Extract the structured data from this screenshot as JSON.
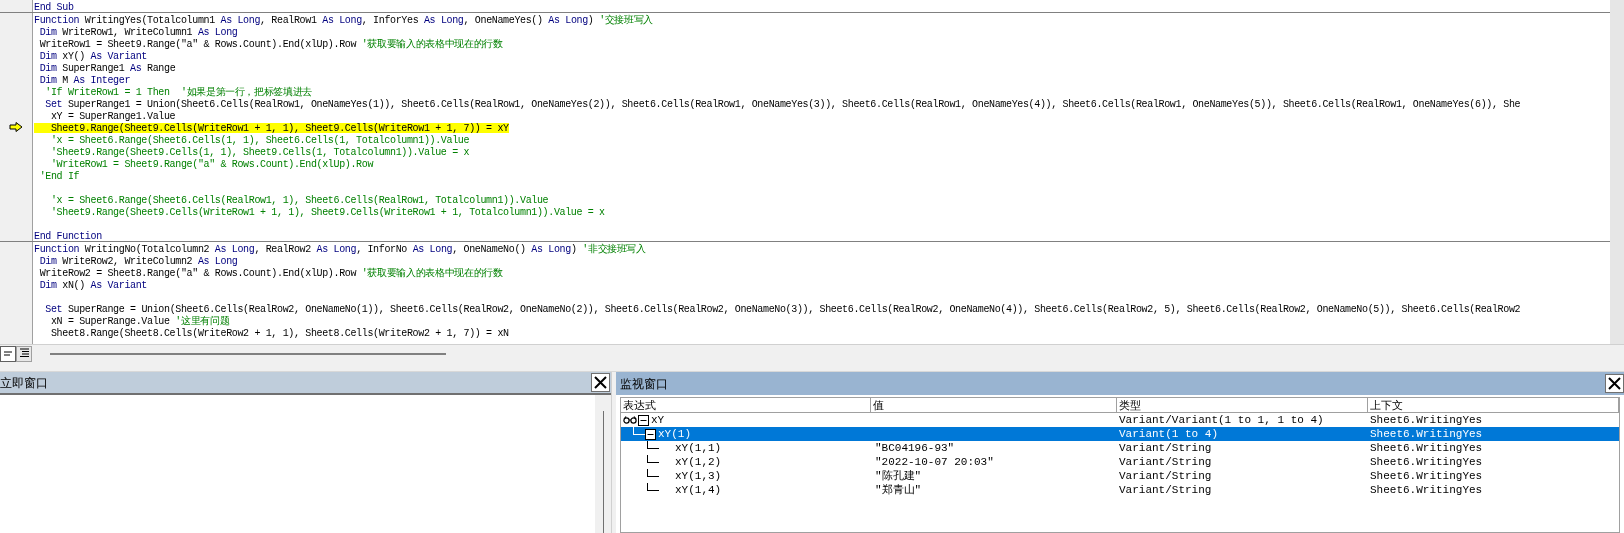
{
  "code_editor": {
    "procedures": [
      {
        "lines": [
          {
            "current": false,
            "segments": [
              {
                "kind": "keyword",
                "text": "End Sub"
              }
            ]
          }
        ]
      },
      {
        "lines": [
          {
            "current": false,
            "segments": [
              {
                "kind": "keyword",
                "text": "Function"
              },
              {
                "kind": "plain",
                "text": " WritingYes(Totalcolumn1 "
              },
              {
                "kind": "keyword",
                "text": "As Long"
              },
              {
                "kind": "plain",
                "text": ", RealRow1 "
              },
              {
                "kind": "keyword",
                "text": "As Long"
              },
              {
                "kind": "plain",
                "text": ", InforYes "
              },
              {
                "kind": "keyword",
                "text": "As Long"
              },
              {
                "kind": "plain",
                "text": ", OneNameYes() "
              },
              {
                "kind": "keyword",
                "text": "As Long"
              },
              {
                "kind": "plain",
                "text": ") "
              },
              {
                "kind": "comment",
                "text": "'交接班写入"
              }
            ]
          },
          {
            "current": false,
            "segments": [
              {
                "kind": "keyword",
                "text": " Dim"
              },
              {
                "kind": "plain",
                "text": " WriteRow1, WriteColumn1 "
              },
              {
                "kind": "keyword",
                "text": "As Long"
              }
            ]
          },
          {
            "current": false,
            "segments": [
              {
                "kind": "plain",
                "text": " WriteRow1 = Sheet9.Range(\"a\" & Rows.Count).End(xlUp).Row "
              },
              {
                "kind": "comment",
                "text": "'获取要输入的表格中现在的行数"
              }
            ]
          },
          {
            "current": false,
            "segments": [
              {
                "kind": "keyword",
                "text": " Dim"
              },
              {
                "kind": "plain",
                "text": " xY() "
              },
              {
                "kind": "keyword",
                "text": "As Variant"
              }
            ]
          },
          {
            "current": false,
            "segments": [
              {
                "kind": "keyword",
                "text": " Dim"
              },
              {
                "kind": "plain",
                "text": " SuperRange1 "
              },
              {
                "kind": "keyword",
                "text": "As"
              },
              {
                "kind": "plain",
                "text": " Range"
              }
            ]
          },
          {
            "current": false,
            "segments": [
              {
                "kind": "keyword",
                "text": " Dim"
              },
              {
                "kind": "plain",
                "text": " M "
              },
              {
                "kind": "keyword",
                "text": "As Integer"
              }
            ]
          },
          {
            "current": false,
            "segments": [
              {
                "kind": "comment",
                "text": "  'If WriteRow1 = 1 Then  '如果是第一行，把标签填进去"
              }
            ]
          },
          {
            "current": false,
            "segments": [
              {
                "kind": "keyword",
                "text": "  Set"
              },
              {
                "kind": "plain",
                "text": " SuperRange1 = Union(Sheet6.Cells(RealRow1, OneNameYes(1)), Sheet6.Cells(RealRow1, OneNameYes(2)), Sheet6.Cells(RealRow1, OneNameYes(3)), Sheet6.Cells(RealRow1, OneNameYes(4)), Sheet6.Cells(RealRow1, OneNameYes(5)), Sheet6.Cells(RealRow1, OneNameYes(6)), She"
              }
            ]
          },
          {
            "current": false,
            "segments": [
              {
                "kind": "plain",
                "text": "   xY = SuperRange1.Value"
              }
            ]
          },
          {
            "current": true,
            "segments": [
              {
                "kind": "plain",
                "text": "   Sheet9.Range(Sheet9.Cells(WriteRow1 + 1, 1), Sheet9.Cells(WriteRow1 + 1, 7)) = xY"
              }
            ]
          },
          {
            "current": false,
            "segments": [
              {
                "kind": "comment",
                "text": "   'x = Sheet6.Range(Sheet6.Cells(1, 1), Sheet6.Cells(1, Totalcolumn1)).Value"
              }
            ]
          },
          {
            "current": false,
            "segments": [
              {
                "kind": "comment",
                "text": "   'Sheet9.Range(Sheet9.Cells(1, 1), Sheet9.Cells(1, Totalcolumn1)).Value = x"
              }
            ]
          },
          {
            "current": false,
            "segments": [
              {
                "kind": "comment",
                "text": "   'WriteRow1 = Sheet9.Range(\"a\" & Rows.Count).End(xlUp).Row"
              }
            ]
          },
          {
            "current": false,
            "segments": [
              {
                "kind": "comment",
                "text": " 'End If"
              }
            ]
          },
          {
            "current": false
          },
          {
            "current": false,
            "segments": [
              {
                "kind": "comment",
                "text": "   'x = Sheet6.Range(Sheet6.Cells(RealRow1, 1), Sheet6.Cells(RealRow1, Totalcolumn1)).Value"
              }
            ]
          },
          {
            "current": false,
            "segments": [
              {
                "kind": "comment",
                "text": "   'Sheet9.Range(Sheet9.Cells(WriteRow1 + 1, 1), Sheet9.Cells(WriteRow1 + 1, Totalcolumn1)).Value = x"
              }
            ]
          },
          {
            "current": false
          },
          {
            "current": false,
            "segments": [
              {
                "kind": "keyword",
                "text": "End Function"
              }
            ]
          }
        ]
      },
      {
        "lines": [
          {
            "current": false,
            "segments": [
              {
                "kind": "keyword",
                "text": "Function"
              },
              {
                "kind": "plain",
                "text": " WritingNo(Totalcolumn2 "
              },
              {
                "kind": "keyword",
                "text": "As Long"
              },
              {
                "kind": "plain",
                "text": ", RealRow2 "
              },
              {
                "kind": "keyword",
                "text": "As Long"
              },
              {
                "kind": "plain",
                "text": ", InforNo "
              },
              {
                "kind": "keyword",
                "text": "As Long"
              },
              {
                "kind": "plain",
                "text": ", OneNameNo() "
              },
              {
                "kind": "keyword",
                "text": "As Long"
              },
              {
                "kind": "plain",
                "text": ") "
              },
              {
                "kind": "comment",
                "text": "'非交接班写入"
              }
            ]
          },
          {
            "current": false,
            "segments": [
              {
                "kind": "keyword",
                "text": " Dim"
              },
              {
                "kind": "plain",
                "text": " WriteRow2, WriteColumn2 "
              },
              {
                "kind": "keyword",
                "text": "As Long"
              }
            ]
          },
          {
            "current": false,
            "segments": [
              {
                "kind": "plain",
                "text": " WriteRow2 = Sheet8.Range(\"a\" & Rows.Count).End(xlUp).Row "
              },
              {
                "kind": "comment",
                "text": "'获取要输入的表格中现在的行数"
              }
            ]
          },
          {
            "current": false,
            "segments": [
              {
                "kind": "keyword",
                "text": " Dim"
              },
              {
                "kind": "plain",
                "text": " xN() "
              },
              {
                "kind": "keyword",
                "text": "As Variant"
              }
            ]
          },
          {
            "current": false
          },
          {
            "current": false,
            "segments": [
              {
                "kind": "keyword",
                "text": "  Set"
              },
              {
                "kind": "plain",
                "text": " SuperRange = Union(Sheet6.Cells(RealRow2, OneNameNo(1)), Sheet6.Cells(RealRow2, OneNameNo(2)), Sheet6.Cells(RealRow2, OneNameNo(3)), Sheet6.Cells(RealRow2, OneNameNo(4)), Sheet6.Cells(RealRow2, 5), Sheet6.Cells(RealRow2, OneNameNo(5)), Sheet6.Cells(RealRow2"
              }
            ]
          },
          {
            "current": false,
            "segments": [
              {
                "kind": "plain",
                "text": "   xN = SuperRange.Value "
              },
              {
                "kind": "comment",
                "text": "'这里有问题"
              }
            ]
          },
          {
            "current": false,
            "segments": [
              {
                "kind": "plain",
                "text": "   Sheet8.Range(Sheet8.Cells(WriteRow2 + 1, 1), Sheet8.Cells(WriteRow2 + 1, 7)) = xN"
              }
            ]
          }
        ]
      }
    ]
  },
  "immediate_window": {
    "title": "立即窗口"
  },
  "watch_window": {
    "title": "监视窗口",
    "columns": [
      "表达式",
      "值",
      "类型",
      "上下文"
    ],
    "items": [
      {
        "expression": "xY",
        "type": "Variant/Variant(1 to 1, 1 to 4)",
        "context": "Sheet6.WritingYes",
        "expanded": true,
        "selected": false,
        "children": [
          {
            "expression": "xY(1)",
            "type": "Variant(1 to 4)",
            "context": "Sheet6.WritingYes",
            "expanded": true,
            "selected": true,
            "children": [
              {
                "expression": "xY(1,1)",
                "value": "\"BC04196-93\"",
                "type": "Variant/String",
                "context": "Sheet6.WritingYes",
                "selected": false
              },
              {
                "expression": "xY(1,2)",
                "value": "\"2022-10-07 20:03\"",
                "type": "Variant/String",
                "context": "Sheet6.WritingYes",
                "selected": false
              },
              {
                "expression": "xY(1,3)",
                "value": "\"陈孔建\"",
                "type": "Variant/String",
                "context": "Sheet6.WritingYes",
                "selected": false
              },
              {
                "expression": "xY(1,4)",
                "value": "\"郑青山\"",
                "type": "Variant/String",
                "context": "Sheet6.WritingYes",
                "selected": false
              }
            ]
          }
        ]
      }
    ]
  }
}
